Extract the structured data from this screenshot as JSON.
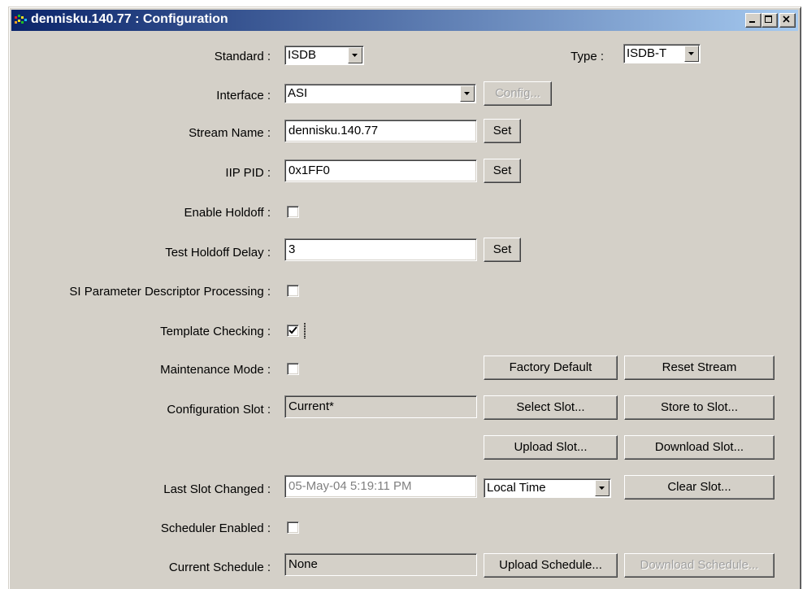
{
  "window": {
    "title": "dennisku.140.77 : Configuration",
    "controls": [
      "minimize-icon",
      "maximize-icon",
      "close-icon"
    ]
  },
  "form": {
    "standard": {
      "label": "Standard :",
      "value": "ISDB"
    },
    "type": {
      "label": "Type :",
      "value": "ISDB-T"
    },
    "interface": {
      "label": "Interface :",
      "value": "ASI",
      "config_button": "Config..."
    },
    "stream_name": {
      "label": "Stream Name :",
      "value": "dennisku.140.77",
      "set_button": "Set"
    },
    "iip_pid": {
      "label": "IIP PID :",
      "value": "0x1FF0",
      "set_button": "Set"
    },
    "enable_holdoff": {
      "label": "Enable Holdoff :",
      "checked": false
    },
    "test_holdoff_delay": {
      "label": "Test Holdoff Delay :",
      "value": "3",
      "set_button": "Set"
    },
    "si_param": {
      "label": "SI Parameter Descriptor Processing :",
      "checked": false
    },
    "template_checking": {
      "label": "Template Checking :",
      "checked": true
    },
    "maintenance_mode": {
      "label": "Maintenance Mode :",
      "checked": false
    },
    "configuration_slot": {
      "label": "Configuration Slot :",
      "value": "Current*"
    },
    "last_slot_changed": {
      "label": "Last Slot Changed :",
      "value": "05-May-04 5:19:11 PM",
      "time_mode": "Local Time"
    },
    "scheduler_enabled": {
      "label": "Scheduler Enabled :",
      "checked": false
    },
    "current_schedule": {
      "label": "Current Schedule :",
      "value": "None"
    }
  },
  "buttons": {
    "factory_default": "Factory Default",
    "reset_stream": "Reset Stream",
    "select_slot": "Select Slot...",
    "store_to_slot": "Store to Slot...",
    "upload_slot": "Upload Slot...",
    "download_slot": "Download Slot...",
    "clear_slot": "Clear Slot...",
    "upload_schedule": "Upload Schedule...",
    "download_schedule": "Download Schedule..."
  },
  "colors": {
    "face": "#d4d0c8",
    "title_active_start": "#0a246a",
    "title_active_end": "#a6caf0",
    "disabled_text": "#808080"
  }
}
